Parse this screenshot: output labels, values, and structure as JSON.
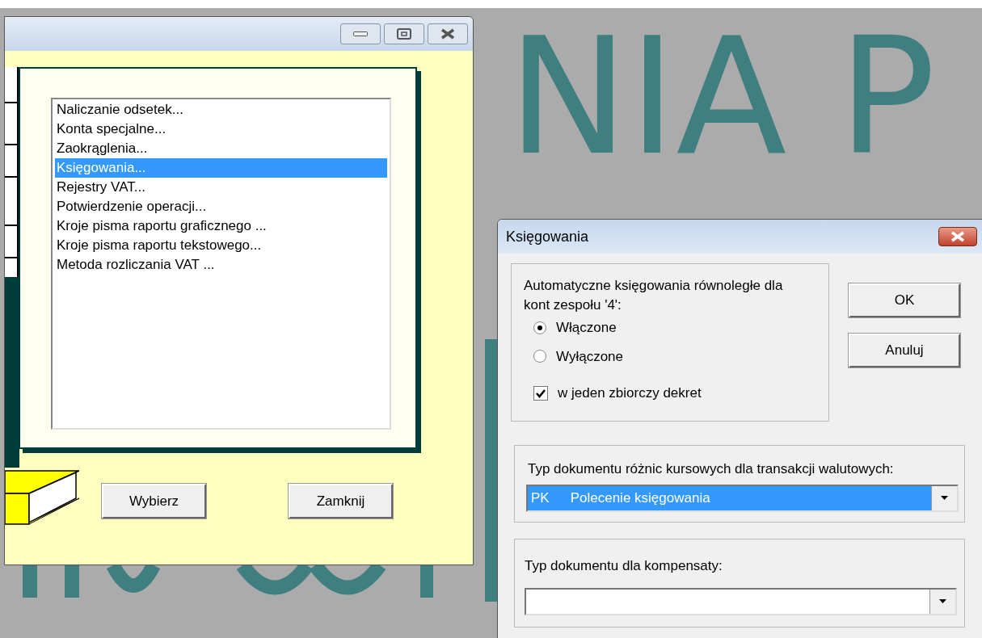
{
  "background": {
    "lettering": "NIA P"
  },
  "main_window": {
    "list_items": [
      {
        "label": "Naliczanie odsetek...",
        "selected": false
      },
      {
        "label": "Konta specjalne...",
        "selected": false
      },
      {
        "label": "Zaokrąglenia...",
        "selected": false
      },
      {
        "label": "Księgowania...",
        "selected": true
      },
      {
        "label": "Rejestry VAT...",
        "selected": false
      },
      {
        "label": "Potwierdzenie operacji...",
        "selected": false
      },
      {
        "label": "Kroje pisma raportu graficznego ...",
        "selected": false
      },
      {
        "label": "Kroje pisma raportu tekstowego...",
        "selected": false
      },
      {
        "label": "Metoda rozliczania VAT ...",
        "selected": false
      }
    ],
    "buttons": [
      {
        "label": "Wybierz"
      },
      {
        "label": "Zamknij"
      }
    ]
  },
  "dialog": {
    "title": "Księgowania",
    "group_label": "Automatyczne księgowania równoległe dla kont zespołu '4':",
    "radios": [
      {
        "label": "Włączone",
        "selected": true
      },
      {
        "label": "Wyłączone",
        "selected": false
      }
    ],
    "checkbox": {
      "label": "w jeden zbiorczy dekret",
      "checked": true
    },
    "buttons": [
      "OK",
      "Anuluj"
    ],
    "exchange_doc": {
      "label": "Typ dokumentu różnic kursowych dla transakcji walutowych:",
      "code": "PK",
      "value": "Polecenie księgowania"
    },
    "compensation_doc": {
      "label": "Typ dokumentu dla kompensaty:"
    }
  }
}
